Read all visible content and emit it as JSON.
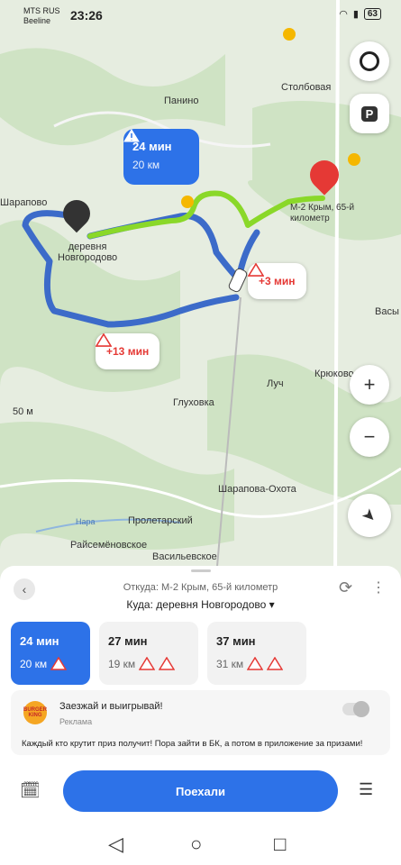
{
  "status": {
    "carrier1": "MTS RUS",
    "carrier2": "Beeline",
    "time": "23:26",
    "battery": "63"
  },
  "map": {
    "places": {
      "panino": "Панино",
      "stolbovaya": "Столбовая",
      "sharapovo": "Шарапово",
      "derevnya1": "деревня",
      "derevnya2": "Новгородово",
      "m2_1": "М-2 Крым, 65-й",
      "m2_2": "километр",
      "glukhovka": "Глуховка",
      "luch": "Луч",
      "kryukovo": "Крюково",
      "sharapova_okhota": "Шарапова-Охота",
      "proletarsky": "Пролетарский",
      "raysemenovskoe": "Райсемёновское",
      "vasilevskoe": "Васильевское",
      "nara": "Нара",
      "vasy": "Васы",
      "scale": "50 м"
    },
    "main_route": {
      "time": "24 мин",
      "distance": "20 км"
    },
    "alt1": "+3 мин",
    "alt2": "+13 мин"
  },
  "panel": {
    "from": "Откуда: М-2 Крым, 65-й километр",
    "to": "Куда: деревня Новгородово ▾",
    "routes": [
      {
        "time": "24 мин",
        "distance": "20 км"
      },
      {
        "time": "27 мин",
        "distance": "19 км"
      },
      {
        "time": "37 мин",
        "distance": "31 км"
      }
    ],
    "ad": {
      "logo": "BURGER KING",
      "title": "Заезжай и выигрывай!",
      "label": "Реклама",
      "text": "Каждый кто крутит приз получит! Пора зайти в БК, а потом в приложение за призами!"
    },
    "go_label": "Поехали"
  },
  "colors": {
    "accent": "#2d72e8",
    "route_green": "#7ed321",
    "route_blue": "#3c6bc9",
    "alert": "#e53935"
  }
}
